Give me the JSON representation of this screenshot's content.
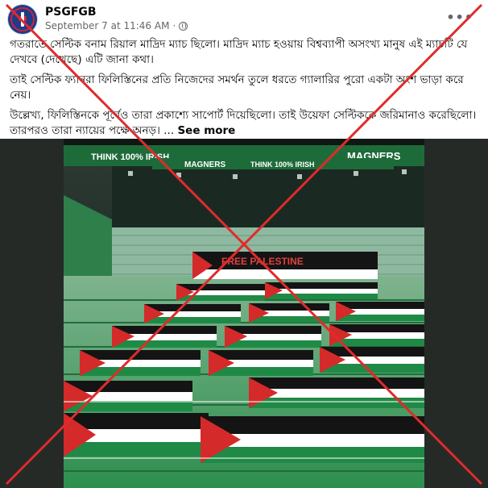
{
  "post": {
    "page_name": "PSGFGB",
    "timestamp": "September 7 at 11:46 AM",
    "separator": "·",
    "paragraphs": [
      "গতরাতে সেল্টিক বনাম রিয়াল মাদ্রিদ ম্যাচ ছিলো। মাদ্রিদ ম্যাচ হওয়ায় বিশ্বব্যাপী অসংখ্য মানুষ এই ম্যাচটি যে দেখবে (দেখেছে) এটি জানা কথা।",
      "তাই সেল্টিক ফ্যানরা ফিলিস্তিনের প্রতি নিজেদের সমর্থন তুলে ধরতে গ্যালারির পুরো একটা অংশ ভাড়া করে নেয়।",
      "উল্লেখ্য, ফিলিস্তিনকে পূর্বেও তারা প্রকাশ্যে সাপোর্ট দিয়েছিলো। তাই উয়েফা সেল্টিককে জরিমানাও করেছিলো। তারপরও তারা ন্যায়ের পক্ষে অনড়। ..."
    ],
    "see_more": "See more",
    "more_icon": "ellipsis-icon",
    "privacy_icon": "globe-icon"
  },
  "photo": {
    "banners": [
      "THINK 100% IRISH",
      "MAGNERS",
      "THINK 100% IRISH",
      "MAGNERS"
    ],
    "banner_color": "#1e6b3a",
    "stand_banner": "FREE PALESTINE"
  },
  "overlay": {
    "cross_color": "#e02b2b",
    "icon": "false-cross-icon"
  }
}
